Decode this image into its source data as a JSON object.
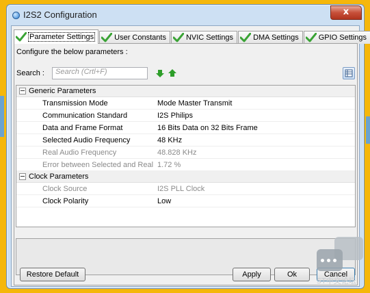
{
  "window": {
    "title": "I2S2 Configuration",
    "close_glyph": "x"
  },
  "tabs": [
    {
      "label": "Parameter Settings",
      "icon": "check-icon",
      "active": true
    },
    {
      "label": "User Constants",
      "icon": "check-icon",
      "active": false
    },
    {
      "label": "NVIC Settings",
      "icon": "check-icon",
      "active": false
    },
    {
      "label": "DMA Settings",
      "icon": "check-icon",
      "active": false
    },
    {
      "label": "GPIO Settings",
      "icon": "check-icon",
      "active": false
    }
  ],
  "hint": "Configure the below parameters :",
  "search": {
    "label": "Search :",
    "placeholder": "Search (Crtl+F)"
  },
  "groups": [
    {
      "name": "Generic Parameters",
      "params": [
        {
          "name": "Transmission Mode",
          "value": "Mode Master Transmit",
          "dim": false
        },
        {
          "name": "Communication Standard",
          "value": "I2S Philips",
          "dim": false
        },
        {
          "name": "Data and Frame Format",
          "value": "16 Bits Data on 32 Bits Frame",
          "dim": false
        },
        {
          "name": "Selected Audio Frequency",
          "value": "48 KHz",
          "dim": false
        },
        {
          "name": "Real Audio Frequency",
          "value": "48.828 KHz",
          "dim": true
        },
        {
          "name": "Error between Selected and Real",
          "value": "1.72 %",
          "dim": true
        }
      ]
    },
    {
      "name": "Clock Parameters",
      "params": [
        {
          "name": "Clock Source",
          "value": "I2S PLL Clock",
          "dim": true
        },
        {
          "name": "Clock Polarity",
          "value": "Low",
          "dim": false
        }
      ]
    }
  ],
  "buttons": {
    "restore": "Restore Default",
    "apply": "Apply",
    "ok": "Ok",
    "cancel": "Cancel"
  },
  "watermark": "ST中文论坛",
  "colors": {
    "backdrop": "#f5b70b",
    "check_green": "#3aa335",
    "arrow_green": "#2e9e2a",
    "close_red": "#c7503a"
  }
}
